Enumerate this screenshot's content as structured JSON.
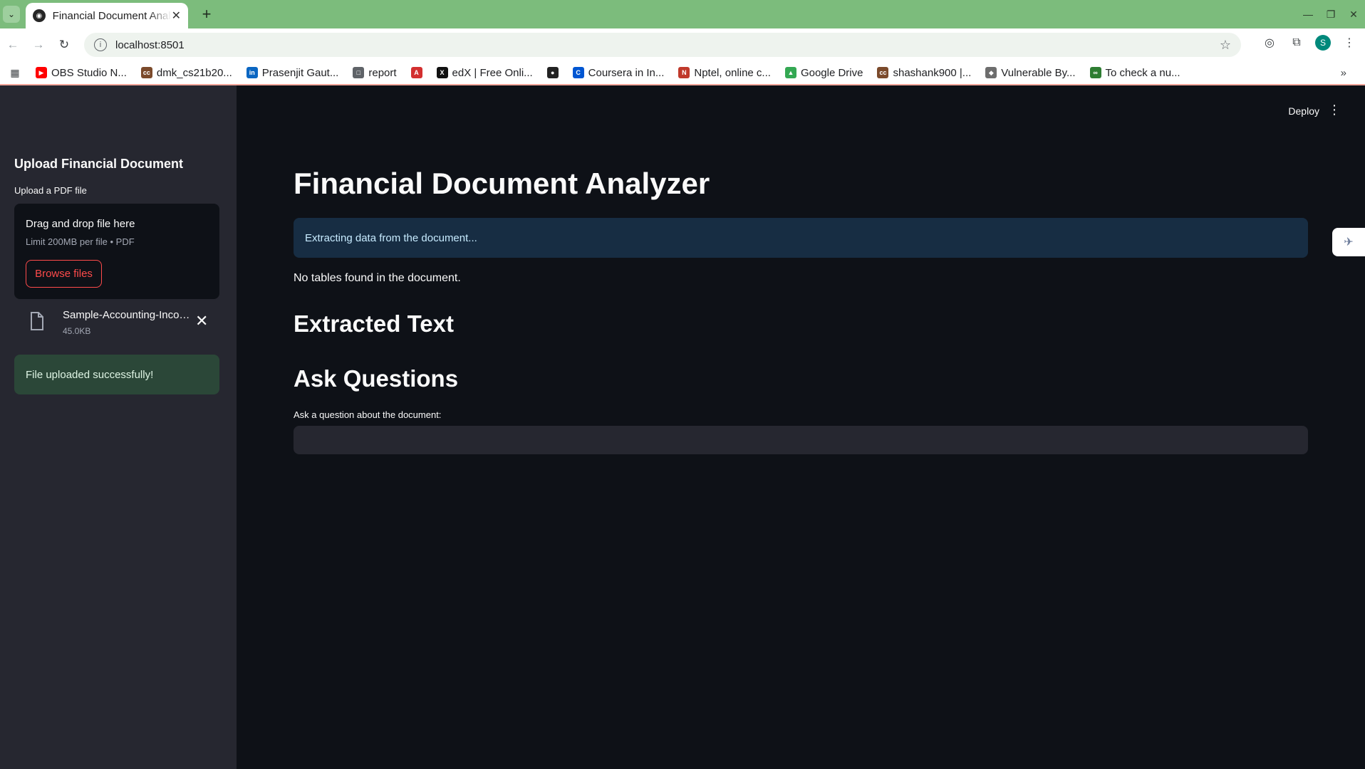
{
  "browser": {
    "tab_title": "Financial Document Analyzer",
    "url": "localhost:8501",
    "profile_initial": "S",
    "bookmarks": [
      {
        "label": "OBS Studio N...",
        "color": "#ff0000",
        "glyph": "▶"
      },
      {
        "label": "dmk_cs21b20...",
        "color": "#7b4a2b",
        "glyph": "cc"
      },
      {
        "label": "Prasenjit Gaut...",
        "color": "#0a66c2",
        "glyph": "in"
      },
      {
        "label": "report",
        "color": "#5f6368",
        "glyph": "□"
      },
      {
        "label": "",
        "color": "#d32f2f",
        "glyph": "A"
      },
      {
        "label": "edX | Free Onli...",
        "color": "#111111",
        "glyph": "X"
      },
      {
        "label": "",
        "color": "#222222",
        "glyph": "●"
      },
      {
        "label": "Coursera in In...",
        "color": "#0056d2",
        "glyph": "C"
      },
      {
        "label": "Nptel, online c...",
        "color": "#c0392b",
        "glyph": "N"
      },
      {
        "label": "Google Drive",
        "color": "#34a853",
        "glyph": "▲"
      },
      {
        "label": "shashank900 |...",
        "color": "#7b4a2b",
        "glyph": "cc"
      },
      {
        "label": "Vulnerable By...",
        "color": "#6d6d6d",
        "glyph": "◆"
      },
      {
        "label": "To check a nu...",
        "color": "#2e7d32",
        "glyph": "∞"
      }
    ]
  },
  "sidebar": {
    "title": "Upload Financial Document",
    "uploader_label": "Upload a PDF file",
    "dropzone_title": "Drag and drop file here",
    "dropzone_limit": "Limit 200MB per file • PDF",
    "browse_label": "Browse files",
    "file_name": "Sample-Accounting-Income-Statement.pdf",
    "file_size": "45.0KB",
    "success_message": "File uploaded successfully!"
  },
  "header": {
    "deploy_label": "Deploy"
  },
  "main": {
    "title": "Financial Document Analyzer",
    "info_message": "Extracting data from the document...",
    "no_tables_message": "No tables found in the document.",
    "extracted_heading": "Extracted Text",
    "ask_heading": "Ask Questions",
    "question_label": "Ask a question about the document:",
    "question_value": ""
  }
}
